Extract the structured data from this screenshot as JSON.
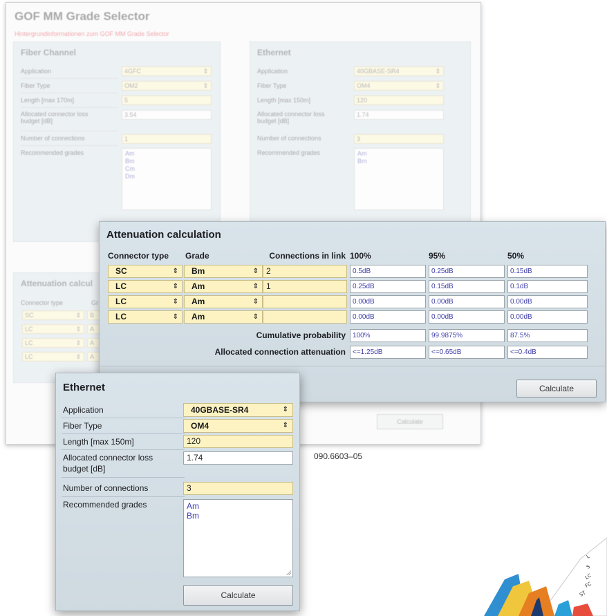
{
  "background_window": {
    "title": "GOF MM Grade Selector",
    "link": "Hintergrundinformationen zum GOF MM Grade Selector",
    "fiber_channel": {
      "title": "Fiber Channel",
      "application_label": "Application",
      "application_value": "4GFC",
      "fiber_type_label": "Fiber Type",
      "fiber_type_value": "OM2",
      "length_label": "Length [max 170m]",
      "length_value": "5",
      "budget_label_1": "Allocated connector loss",
      "budget_label_2": "budget [dB]",
      "budget_value": "3.54",
      "connections_label": "Number of connections",
      "connections_value": "1",
      "grades_label": "Recommended grades",
      "grades": [
        "Am",
        "Bm",
        "Cm",
        "Dm"
      ]
    },
    "ethernet": {
      "title": "Ethernet",
      "application_label": "Application",
      "application_value": "40GBASE-SR4",
      "fiber_type_label": "Fiber Type",
      "fiber_type_value": "OM4",
      "length_label": "Length [max 150m]",
      "length_value": "120",
      "budget_label_1": "Allocated connector loss",
      "budget_label_2": "budget [dB]",
      "budget_value": "1.74",
      "connections_label": "Number of connections",
      "connections_value": "3",
      "grades_label": "Recommended grades",
      "grades": [
        "Am",
        "Bm"
      ],
      "calculate_label": "Calculate"
    },
    "attenuation": {
      "title": "Attenuation calcul",
      "connector_label": "Connector type",
      "grade_label": "Gr",
      "rows": [
        {
          "connector": "SC",
          "grade": "B"
        },
        {
          "connector": "LC",
          "grade": "A"
        },
        {
          "connector": "LC",
          "grade": "A"
        },
        {
          "connector": "LC",
          "grade": "A"
        }
      ]
    }
  },
  "attenuation_window": {
    "title": "Attenuation calculation",
    "headers": {
      "connector_type": "Connector type",
      "grade": "Grade",
      "connections_in_link": "Connections in link",
      "p100": "100%",
      "p95": "95%",
      "p50": "50%"
    },
    "rows": [
      {
        "connector": "SC",
        "grade": "Bm",
        "connections": "2",
        "p100": "0.5dB",
        "p95": "0.25dB",
        "p50": "0.15dB"
      },
      {
        "connector": "LC",
        "grade": "Am",
        "connections": "1",
        "p100": "0.25dB",
        "p95": "0.15dB",
        "p50": "0.1dB"
      },
      {
        "connector": "LC",
        "grade": "Am",
        "connections": "",
        "p100": "0.00dB",
        "p95": "0.00dB",
        "p50": "0.00dB"
      },
      {
        "connector": "LC",
        "grade": "Am",
        "connections": "",
        "p100": "0.00dB",
        "p95": "0.00dB",
        "p50": "0.00dB"
      }
    ],
    "cumulative_label": "Cumulative probability",
    "cumulative": {
      "p100": "100%",
      "p95": "99.9875%",
      "p50": "87.5%"
    },
    "allocated_label": "Allocated connection attenuation",
    "allocated": {
      "p100": "<=1.25dB",
      "p95": "<=0.65dB",
      "p50": "<=0.4dB"
    },
    "calculate_label": "Calculate"
  },
  "ethernet_window": {
    "title": "Ethernet",
    "application_label": "Application",
    "application_value": "40GBASE-SR4",
    "fiber_type_label": "Fiber Type",
    "fiber_type_value": "OM4",
    "length_label": "Length [max 150m]",
    "length_value": "120",
    "budget_label_1": "Allocated connector loss",
    "budget_label_2": "budget [dB]",
    "budget_value": "1.74",
    "connections_label": "Number of connections",
    "connections_value": "3",
    "grades_label": "Recommended grades",
    "grades": [
      "Am",
      "Bm"
    ],
    "calculate_label": "Calculate"
  },
  "caption": "090.6603–05",
  "icons": {
    "select_arrow": "updown-arrow-icon",
    "resize": "resize-grip-icon"
  },
  "colors": {
    "panel": "#d9e3ea",
    "field_yellow": "#fdf3c2",
    "output_text": "#4141a8",
    "link_red": "#e8535b"
  }
}
